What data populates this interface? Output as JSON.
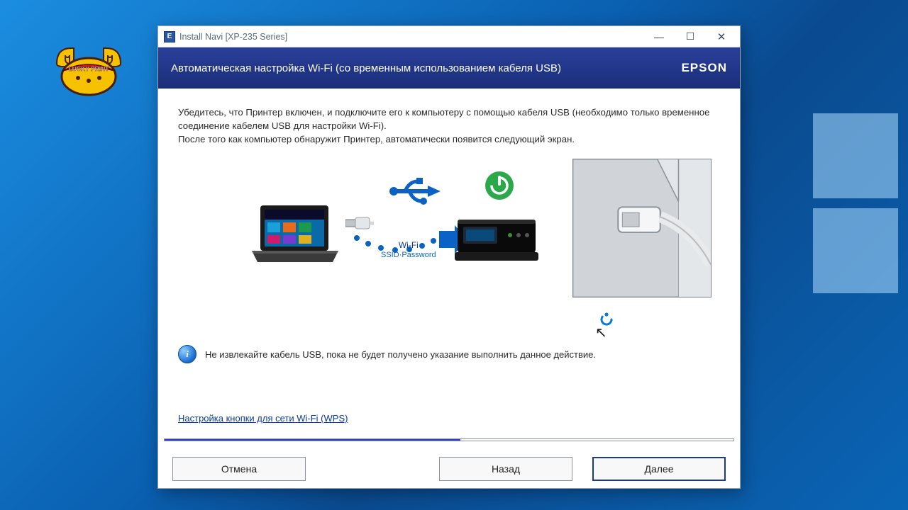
{
  "window": {
    "title": "Install Navi [XP-235 Series]",
    "app_icon_letter": "E"
  },
  "header": {
    "title": "Автоматическая настройка Wi-Fi (со временным использованием кабеля USB)",
    "brand": "EPSON"
  },
  "body": {
    "p1": "Убедитесь, что Принтер включен, и подключите его к компьютеру с помощью кабеля USB (необходимо только временное соединение кабелем USB для настройки Wi-Fi).",
    "p2": "После того как компьютер обнаружит Принтер, автоматически появится следующий экран.",
    "diagram": {
      "wifi_label": "Wi-Fi",
      "ssid_label": "SSID·Password"
    },
    "info_note": "Не извлекайте кабель USB, пока не будет получено указание выполнить данное действие.",
    "wps_link": "Настройка кнопки для сети Wi-Fi (WPS)"
  },
  "progress": {
    "percent": 52
  },
  "buttons": {
    "cancel": "Отмена",
    "back": "Назад",
    "next": "Далее"
  },
  "badge": {
    "text": "LUCKY PRINT"
  }
}
